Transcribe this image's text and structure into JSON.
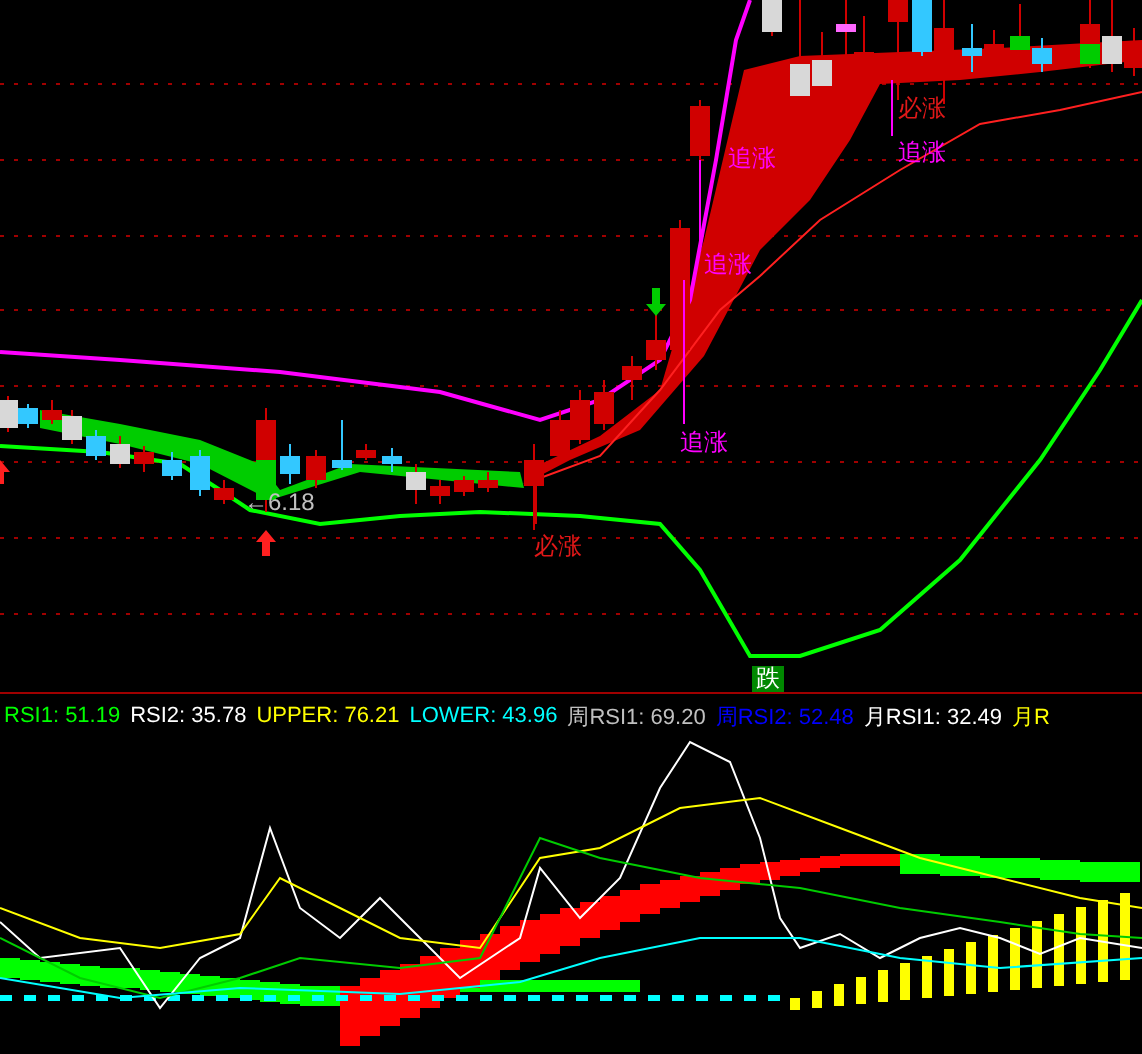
{
  "price_chart": {
    "annotations": [
      {
        "text": "追涨",
        "color": "#ff00ff"
      },
      {
        "text": "追涨",
        "color": "#ff00ff"
      },
      {
        "text": "追涨",
        "color": "#ff00ff"
      },
      {
        "text": "必涨",
        "color": "#e01818"
      },
      {
        "text": "追涨",
        "color": "#ff00ff"
      },
      {
        "text": "必涨",
        "color": "#e01818"
      }
    ],
    "low_marker": "←6.18",
    "signal": "跌"
  },
  "indicator": {
    "legend": [
      {
        "label": "RSI1: 51.19",
        "color": "#00ff00"
      },
      {
        "label": "RSI2: 35.78",
        "color": "#ffffff"
      },
      {
        "label": "UPPER: 76.21",
        "color": "#ffff00"
      },
      {
        "label": "LOWER: 43.96",
        "color": "#00ffff"
      },
      {
        "label": "周RSI1: 69.20",
        "color": "#c0c0c0"
      },
      {
        "label": "周RSI2: 52.48",
        "color": "#0000ff"
      },
      {
        "label": "月RSI1: 32.49",
        "color": "#ffffff"
      },
      {
        "label": "月R",
        "color": "#ffff00"
      }
    ]
  }
}
